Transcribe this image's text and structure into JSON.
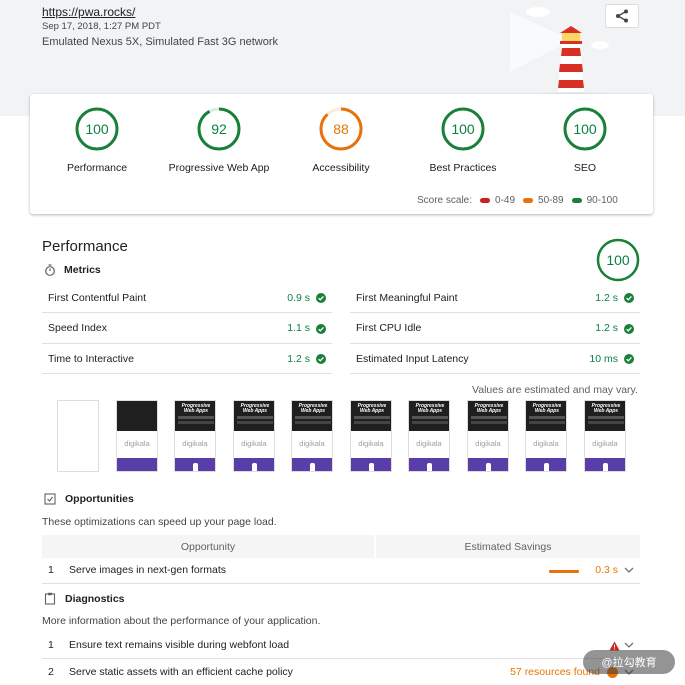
{
  "header": {
    "url": "https://pwa.rocks/",
    "date": "Sep 17, 2018, 1:27 PM PDT",
    "environment": "Emulated Nexus 5X, Simulated Fast 3G network",
    "share_icon": "share-icon"
  },
  "colors": {
    "pass": "#0b8043",
    "average": "#e67700",
    "fail": "#c7221f",
    "pass_ring": "#188038",
    "average_ring": "#e8710a"
  },
  "scores": [
    {
      "label": "Performance",
      "value": "100",
      "status": "pass"
    },
    {
      "label": "Progressive Web App",
      "value": "92",
      "status": "pass"
    },
    {
      "label": "Accessibility",
      "value": "88",
      "status": "average"
    },
    {
      "label": "Best Practices",
      "value": "100",
      "status": "pass"
    },
    {
      "label": "SEO",
      "value": "100",
      "status": "pass"
    }
  ],
  "score_scale": {
    "label": "Score scale:",
    "ranges": [
      "0-49",
      "50-89",
      "90-100"
    ]
  },
  "performance": {
    "title": "Performance",
    "score": "100",
    "metrics_heading": "Metrics",
    "metrics": [
      {
        "label": "First Contentful Paint",
        "value": "0.9 s"
      },
      {
        "label": "First Meaningful Paint",
        "value": "1.2 s"
      },
      {
        "label": "Speed Index",
        "value": "1.1 s"
      },
      {
        "label": "First CPU Idle",
        "value": "1.2 s"
      },
      {
        "label": "Time to Interactive",
        "value": "1.2 s"
      },
      {
        "label": "Estimated Input Latency",
        "value": "10 ms"
      }
    ],
    "note": "Values are estimated and may vary."
  },
  "filmstrip": {
    "frame_title": "Progressive Web Apps",
    "frame_brand": "digikala"
  },
  "opportunities": {
    "heading": "Opportunities",
    "description": "These optimizations can speed up your page load.",
    "col_opportunity": "Opportunity",
    "col_savings": "Estimated Savings",
    "items": [
      {
        "num": "1",
        "label": "Serve images in next-gen formats",
        "savings": "0.3 s",
        "fraction": 0.55
      }
    ]
  },
  "diagnostics": {
    "heading": "Diagnostics",
    "description": "More information about the performance of your application.",
    "items": [
      {
        "num": "1",
        "label": "Ensure text remains visible during webfont load",
        "value": ""
      },
      {
        "num": "2",
        "label": "Serve static assets with an efficient cache policy",
        "value": "57 resources found"
      }
    ]
  },
  "watermark": {
    "text": "@拉勾教育"
  }
}
